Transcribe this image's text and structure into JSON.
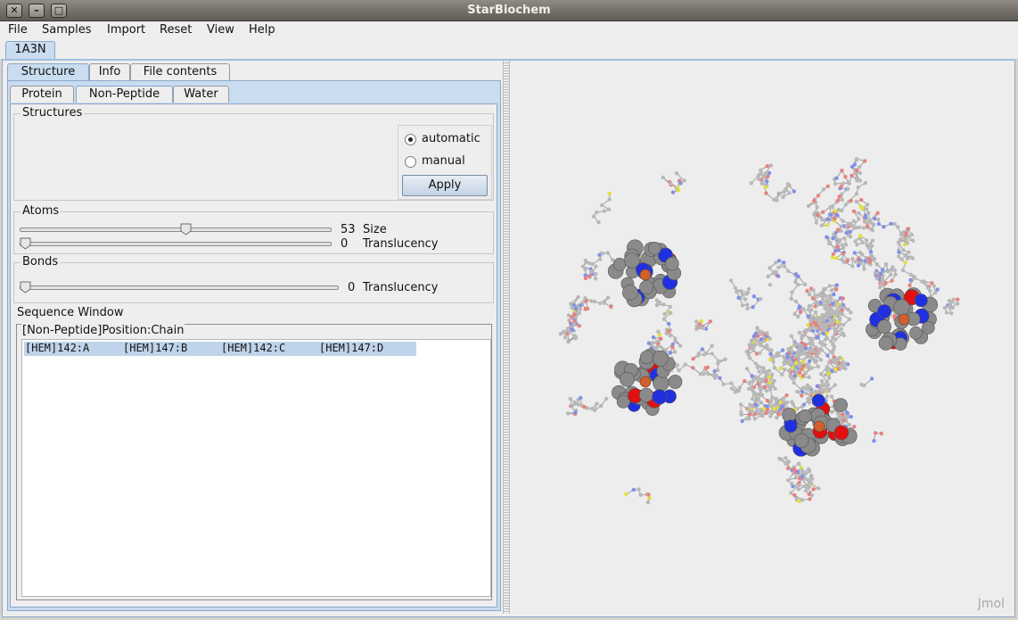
{
  "window": {
    "title": "StarBiochem"
  },
  "menu": [
    "File",
    "Samples",
    "Import",
    "Reset",
    "View",
    "Help"
  ],
  "document_tab": "1A3N",
  "left": {
    "tabs": [
      "Structure",
      "Info",
      "File contents"
    ],
    "subtabs": [
      "Protein",
      "Non-Peptide",
      "Water"
    ],
    "structures": {
      "title": "Structures",
      "opt_auto": "automatic",
      "opt_manual": "manual",
      "selected": "automatic",
      "apply": "Apply"
    },
    "atoms": {
      "title": "Atoms",
      "size_value": "53",
      "size_label": "Size",
      "trans_value": "0",
      "trans_label": "Translucency",
      "size_fraction": 0.53,
      "trans_fraction": 0
    },
    "bonds": {
      "title": "Bonds",
      "trans_value": "0",
      "trans_label": "Translucency",
      "trans_fraction": 0
    },
    "sequence": {
      "title": "Sequence Window",
      "header": "[Non-Peptide]Position:Chain",
      "items": [
        "[HEM]142:A",
        "[HEM]147:B",
        "[HEM]142:C",
        "[HEM]147:D"
      ]
    }
  },
  "viewer": {
    "watermark": "Jmol"
  },
  "colors": {
    "tab_selected": "#c9dcf0",
    "carbon": "#8a8a8a",
    "oxygen": "#e01010",
    "nitrogen": "#2030e0",
    "iron": "#d06030"
  }
}
